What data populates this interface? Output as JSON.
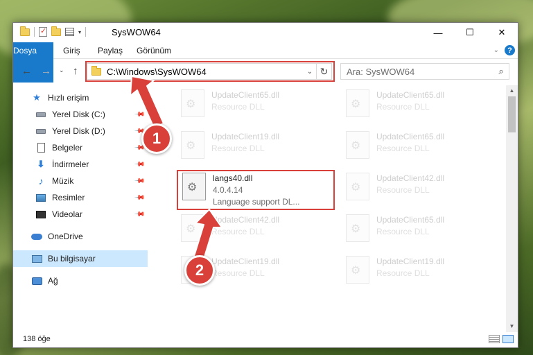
{
  "window": {
    "title": "SysWOW64"
  },
  "ribbon": {
    "tabs": [
      "Dosya",
      "Giriş",
      "Paylaş",
      "Görünüm"
    ],
    "help": "?"
  },
  "navbar": {
    "address": "C:\\Windows\\SysWOW64",
    "search_placeholder": "Ara: SysWOW64"
  },
  "sidebar": {
    "items": [
      {
        "label": "Hızlı erişim",
        "icon": "star-icon"
      },
      {
        "label": "Yerel Disk (C:)",
        "icon": "drive-icon",
        "pinned": true
      },
      {
        "label": "Yerel Disk (D:)",
        "icon": "drive-icon",
        "pinned": true
      },
      {
        "label": "Belgeler",
        "icon": "document-icon",
        "pinned": true
      },
      {
        "label": "İndirmeler",
        "icon": "download-icon",
        "pinned": true
      },
      {
        "label": "Müzik",
        "icon": "music-icon",
        "pinned": true
      },
      {
        "label": "Resimler",
        "icon": "pictures-icon",
        "pinned": true
      },
      {
        "label": "Videolar",
        "icon": "videos-icon",
        "pinned": true
      },
      {
        "label": "OneDrive",
        "icon": "cloud-icon"
      },
      {
        "label": "Bu bilgisayar",
        "icon": "computer-icon",
        "selected": true
      },
      {
        "label": "Ağ",
        "icon": "network-icon"
      }
    ]
  },
  "files": [
    {
      "name": "UpdateClient65.dll",
      "sub": "Resource DLL",
      "faded": true
    },
    {
      "name": "UpdateClient65.dll",
      "sub": "Resource DLL",
      "faded": true
    },
    {
      "name": "UpdateClient19.dll",
      "sub": "Resource DLL",
      "faded": true
    },
    {
      "name": "UpdateClient65.dll",
      "sub": "Resource DLL",
      "faded": true
    },
    {
      "name": "langs40.dll",
      "version": "4.0.4.14",
      "sub": "Language support DL...",
      "faded": false
    },
    {
      "name": "UpdateClient42.dll",
      "sub": "Resource DLL",
      "faded": true
    },
    {
      "name": "UpdateClient42.dll",
      "sub": "Resource DLL",
      "faded": true
    },
    {
      "name": "UpdateClient65.dll",
      "sub": "Resource DLL",
      "faded": true
    },
    {
      "name": "UpdateClient19.dll",
      "sub": "Resource DLL",
      "faded": true
    },
    {
      "name": "UpdateClient19.dll",
      "sub": "Resource DLL",
      "faded": true
    }
  ],
  "status": {
    "count": "138 öğe"
  },
  "annotations": {
    "step1": "1",
    "step2": "2",
    "color": "#d9403a"
  }
}
